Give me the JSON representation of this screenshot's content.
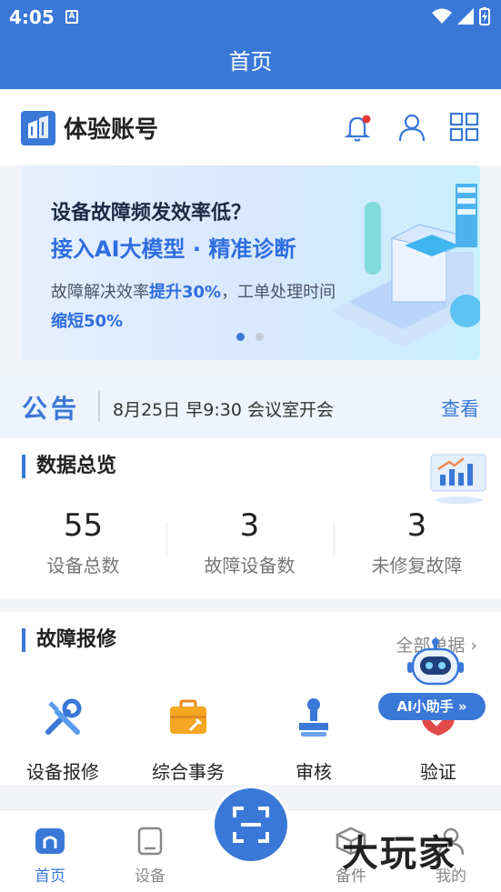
{
  "status_bar": {
    "time": "4:05",
    "a_badge": "A"
  },
  "title_bar": {
    "title": "首页"
  },
  "account": {
    "name": "体验账号"
  },
  "banner": {
    "line1": "设备故障频发效率低？",
    "line2": "接入AI大模型 · 精准诊断",
    "line3_prefix": "故障解决效率",
    "line3_highlight": "提升30%",
    "line3_suffix": "，工单处理时间",
    "line4": "缩短50%",
    "slide_current": 1,
    "slide_total": 2
  },
  "notice": {
    "tag": "公告",
    "text": "8月25日 早9:30 会议室开会",
    "action": "查看"
  },
  "overview": {
    "title": "数据总览",
    "stats": [
      {
        "value": "55",
        "label": "设备总数"
      },
      {
        "value": "3",
        "label": "故障设备数"
      },
      {
        "value": "3",
        "label": "未修复故障"
      }
    ]
  },
  "repair": {
    "title": "故障报修",
    "more": "全部单据",
    "items": [
      {
        "label": "设备报修",
        "icon": "tools-icon"
      },
      {
        "label": "综合事务",
        "icon": "toolbox-icon"
      },
      {
        "label": "审核",
        "icon": "stamp-icon"
      },
      {
        "label": "验证",
        "icon": "shield-check-icon"
      }
    ]
  },
  "ai_assistant": {
    "label": "AI小助手"
  },
  "tabs": [
    {
      "label": "首页",
      "icon": "home-icon",
      "active": true
    },
    {
      "label": "设备",
      "icon": "device-icon",
      "active": false
    },
    {
      "label": "备件",
      "icon": "box-icon",
      "active": false
    },
    {
      "label": "我的",
      "icon": "user-icon",
      "active": false
    }
  ],
  "watermark": "大玩家",
  "colors": {
    "primary": "#3a78d8",
    "alert_dot": "#e53935",
    "orange": "#f5a623"
  }
}
